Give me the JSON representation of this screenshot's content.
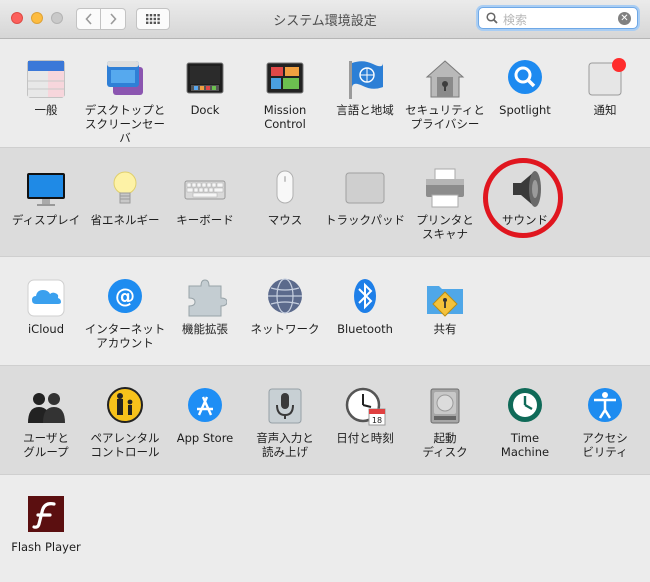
{
  "window": {
    "title": "システム環境設定"
  },
  "search": {
    "placeholder": "検索"
  },
  "rows": [
    {
      "items": [
        {
          "label": "一般",
          "icon": "general-icon"
        },
        {
          "label": "デスクトップと\nスクリーンセーバ",
          "icon": "desktop-icon"
        },
        {
          "label": "Dock",
          "icon": "dock-icon"
        },
        {
          "label": "Mission\nControl",
          "icon": "mission-control-icon"
        },
        {
          "label": "言語と地域",
          "icon": "flag-icon"
        },
        {
          "label": "セキュリティと\nプライバシー",
          "icon": "security-icon"
        },
        {
          "label": "Spotlight",
          "icon": "spotlight-icon"
        },
        {
          "label": "通知",
          "icon": "notifications-icon"
        }
      ]
    },
    {
      "items": [
        {
          "label": "ディスプレイ",
          "icon": "display-icon"
        },
        {
          "label": "省エネルギー",
          "icon": "lightbulb-icon"
        },
        {
          "label": "キーボード",
          "icon": "keyboard-icon"
        },
        {
          "label": "マウス",
          "icon": "mouse-icon"
        },
        {
          "label": "トラックパッド",
          "icon": "trackpad-icon"
        },
        {
          "label": "プリンタと\nスキャナ",
          "icon": "printer-icon"
        },
        {
          "label": "サウンド",
          "icon": "speaker-icon"
        }
      ]
    },
    {
      "items": [
        {
          "label": "iCloud",
          "icon": "icloud-icon"
        },
        {
          "label": "インターネット\nアカウント",
          "icon": "internet-accounts-icon"
        },
        {
          "label": "機能拡張",
          "icon": "extensions-icon"
        },
        {
          "label": "ネットワーク",
          "icon": "network-icon"
        },
        {
          "label": "Bluetooth",
          "icon": "bluetooth-icon"
        },
        {
          "label": "共有",
          "icon": "sharing-icon"
        }
      ]
    },
    {
      "items": [
        {
          "label": "ユーザと\nグループ",
          "icon": "users-icon"
        },
        {
          "label": "ペアレンタル\nコントロール",
          "icon": "parental-icon"
        },
        {
          "label": "App Store",
          "icon": "appstore-icon"
        },
        {
          "label": "音声入力と\n読み上げ",
          "icon": "microphone-icon"
        },
        {
          "label": "日付と時刻",
          "icon": "clock-icon"
        },
        {
          "label": "起動\nディスク",
          "icon": "disk-icon"
        },
        {
          "label": "Time\nMachine",
          "icon": "time-machine-icon"
        },
        {
          "label": "アクセシ\nビリティ",
          "icon": "accessibility-icon"
        }
      ]
    },
    {
      "items": [
        {
          "label": "Flash Player",
          "icon": "flash-icon"
        }
      ]
    }
  ],
  "icon_tiles": {
    "general": "File\nNew\nOne",
    "calendar_day": "18"
  },
  "highlight_color": "#e0161f"
}
